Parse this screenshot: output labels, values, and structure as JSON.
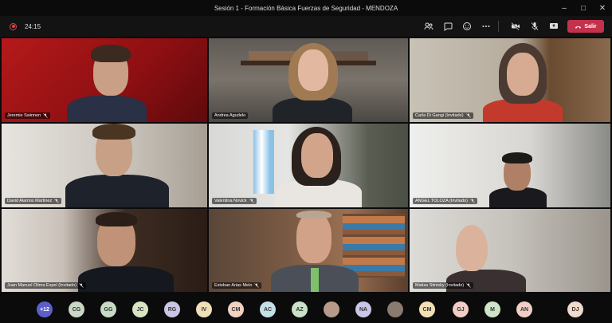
{
  "window": {
    "title": "Sesión 1 - Formación Básica Fuerzas de Seguridad - MENDOZA"
  },
  "toolbar": {
    "timer": "24:15",
    "leave_label": "Salir",
    "icons": [
      "participants-icon",
      "chat-icon",
      "reactions-icon",
      "more-icon",
      "camera-off-icon",
      "mic-off-icon",
      "share-icon"
    ]
  },
  "participants": [
    {
      "name": "Jeremie Swinnen"
    },
    {
      "name": "Andrea Agudelo"
    },
    {
      "name": "Carla Di Gangi (Invitado)"
    },
    {
      "name": "David Alamos Martinez"
    },
    {
      "name": "Valentina Novick"
    },
    {
      "name": "ANGEL TOLOZA (Invitado)"
    },
    {
      "name": "Juan Manuel Olima Espel (Invitado)"
    },
    {
      "name": "Esteban Arias Melo"
    },
    {
      "name": "Matias Sitnisky (Invitado)"
    }
  ],
  "overflow": {
    "count": "+12",
    "avatars": [
      {
        "initials": "CG",
        "color": "#c9d8c4"
      },
      {
        "initials": "GG",
        "color": "#c8dcc5"
      },
      {
        "initials": "JC",
        "color": "#d9e4c3"
      },
      {
        "initials": "RG",
        "color": "#c9c6e6"
      },
      {
        "initials": "IV",
        "color": "#f0e0b8"
      },
      {
        "initials": "CM",
        "color": "#f1d1c1"
      },
      {
        "initials": "AC",
        "color": "#c4e0e5"
      },
      {
        "initials": "AZ",
        "color": "#c9e2c7"
      },
      {
        "initials": "",
        "color": "#b89a8a"
      },
      {
        "initials": "NA",
        "color": "#c9c6e6"
      },
      {
        "initials": "",
        "color": "#8a7a70"
      },
      {
        "initials": "CM",
        "color": "#f3dfb4"
      },
      {
        "initials": "GJ",
        "color": "#f1cdc6"
      },
      {
        "initials": "M",
        "color": "#cfe4c7"
      },
      {
        "initials": "AN",
        "color": "#f1cdc6"
      },
      {
        "initials": "DJ",
        "color": "#f1d9cb"
      }
    ]
  }
}
